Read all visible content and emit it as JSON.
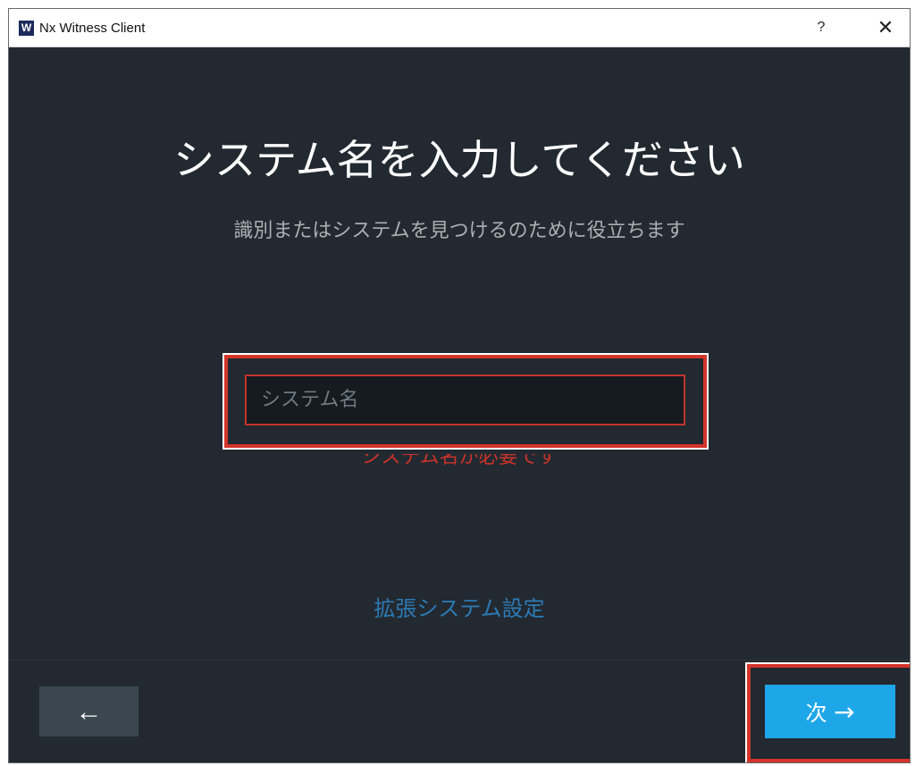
{
  "window": {
    "title": "Nx Witness Client",
    "logo_letter": "W",
    "help_label": "?",
    "close_label": "✕"
  },
  "main": {
    "title": "システム名を入力してください",
    "subtitle": "識別またはシステムを見つけるのために役立ちます",
    "system_name_placeholder": "システム名",
    "system_name_value": "",
    "error_text": "システム名が必要です",
    "advanced_link": "拡張システム設定"
  },
  "footer": {
    "back_label": "←",
    "next_label": "次",
    "next_arrow": "→"
  },
  "colors": {
    "background": "#222930",
    "primary_button": "#1ea7e8",
    "error": "#c8332a",
    "link": "#2d7ab4",
    "highlight_box": "#d4342a"
  }
}
